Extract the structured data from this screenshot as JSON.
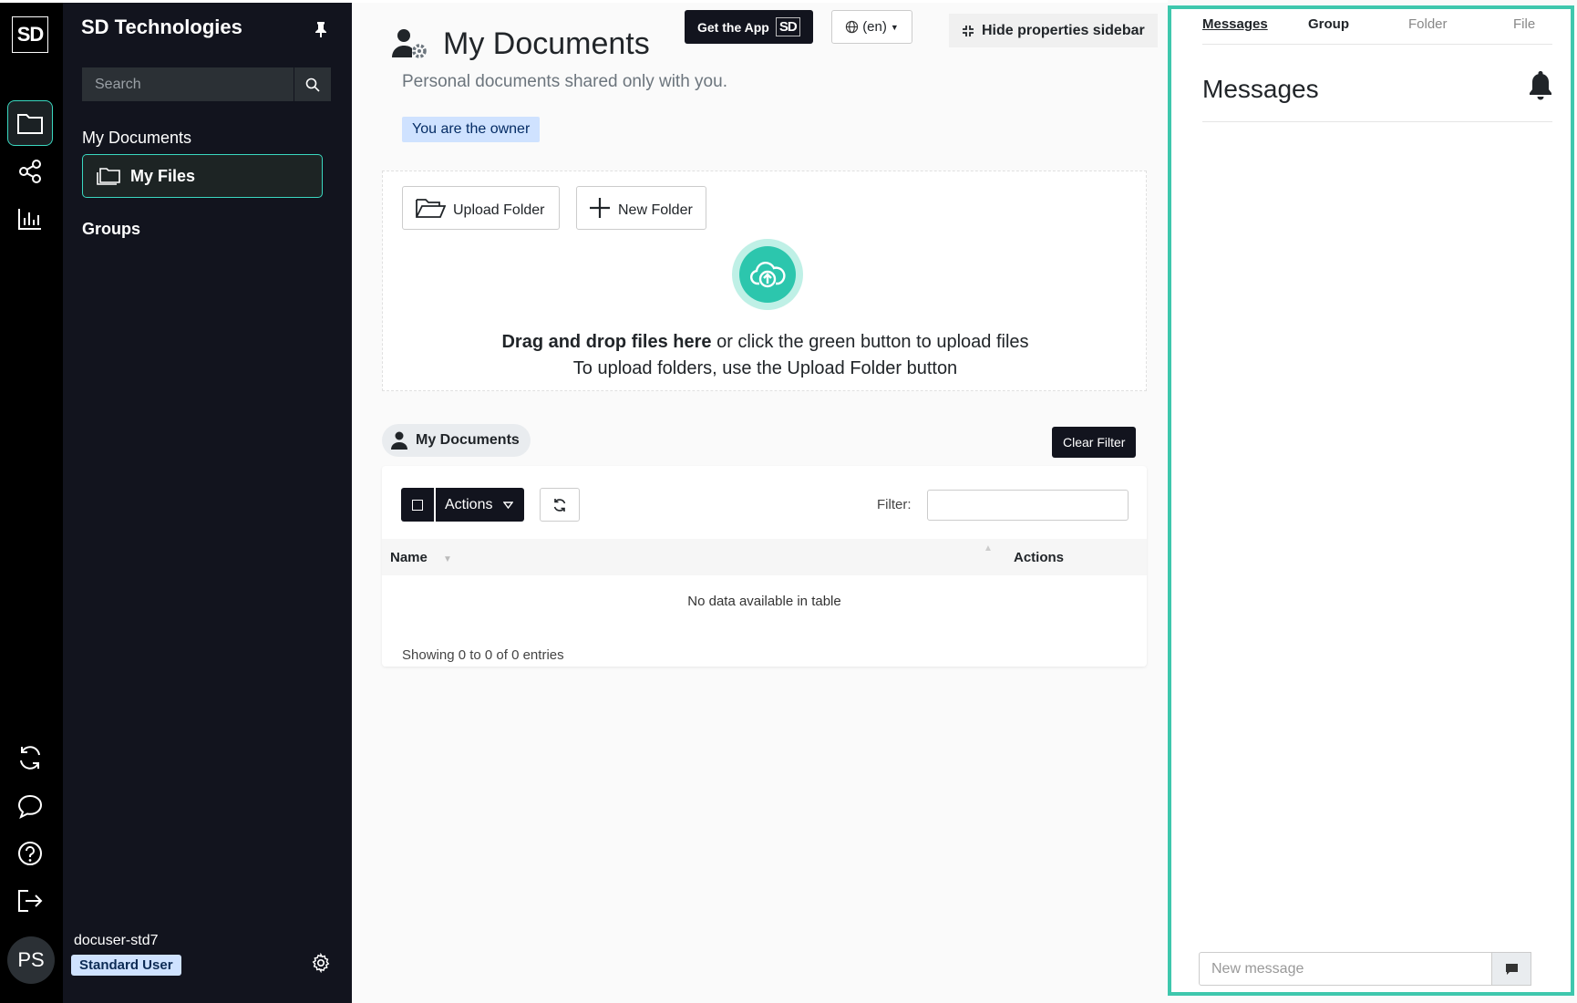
{
  "rail": {
    "logo": "SD",
    "avatar_initials": "PS"
  },
  "nav": {
    "brand": "SD Technologies",
    "search_placeholder": "Search",
    "section_my_documents": "My Documents",
    "item_my_files": "My Files",
    "section_groups": "Groups",
    "user_name": "docuser-std7",
    "user_role": "Standard User"
  },
  "header": {
    "get_app": "Get the App",
    "get_app_badge": "SD",
    "language": "(en)",
    "hide_sidebar": "Hide properties sidebar"
  },
  "page": {
    "title": "My Documents",
    "subtitle": "Personal documents shared only with you.",
    "owner_badge": "You are the owner"
  },
  "dropzone": {
    "upload_folder": "Upload Folder",
    "new_folder": "New Folder",
    "drag_bold": "Drag and drop files here",
    "drag_rest": " or click the green button to upload files",
    "folders_hint": "To upload folders, use the Upload Folder button"
  },
  "listing": {
    "breadcrumb": "My Documents",
    "clear_filter": "Clear Filter",
    "actions_label": "Actions",
    "filter_label": "Filter:",
    "columns": [
      "Name",
      "Actions"
    ],
    "empty_message": "No data available in table",
    "showing": "Showing 0 to 0 of 0 entries"
  },
  "props": {
    "tabs": [
      "Messages",
      "Group",
      "Folder",
      "File"
    ],
    "title": "Messages",
    "new_message_placeholder": "New message"
  },
  "colors": {
    "accent": "#3ec7ad",
    "dark": "#12141e",
    "badge_bg": "#cfe2ff"
  }
}
